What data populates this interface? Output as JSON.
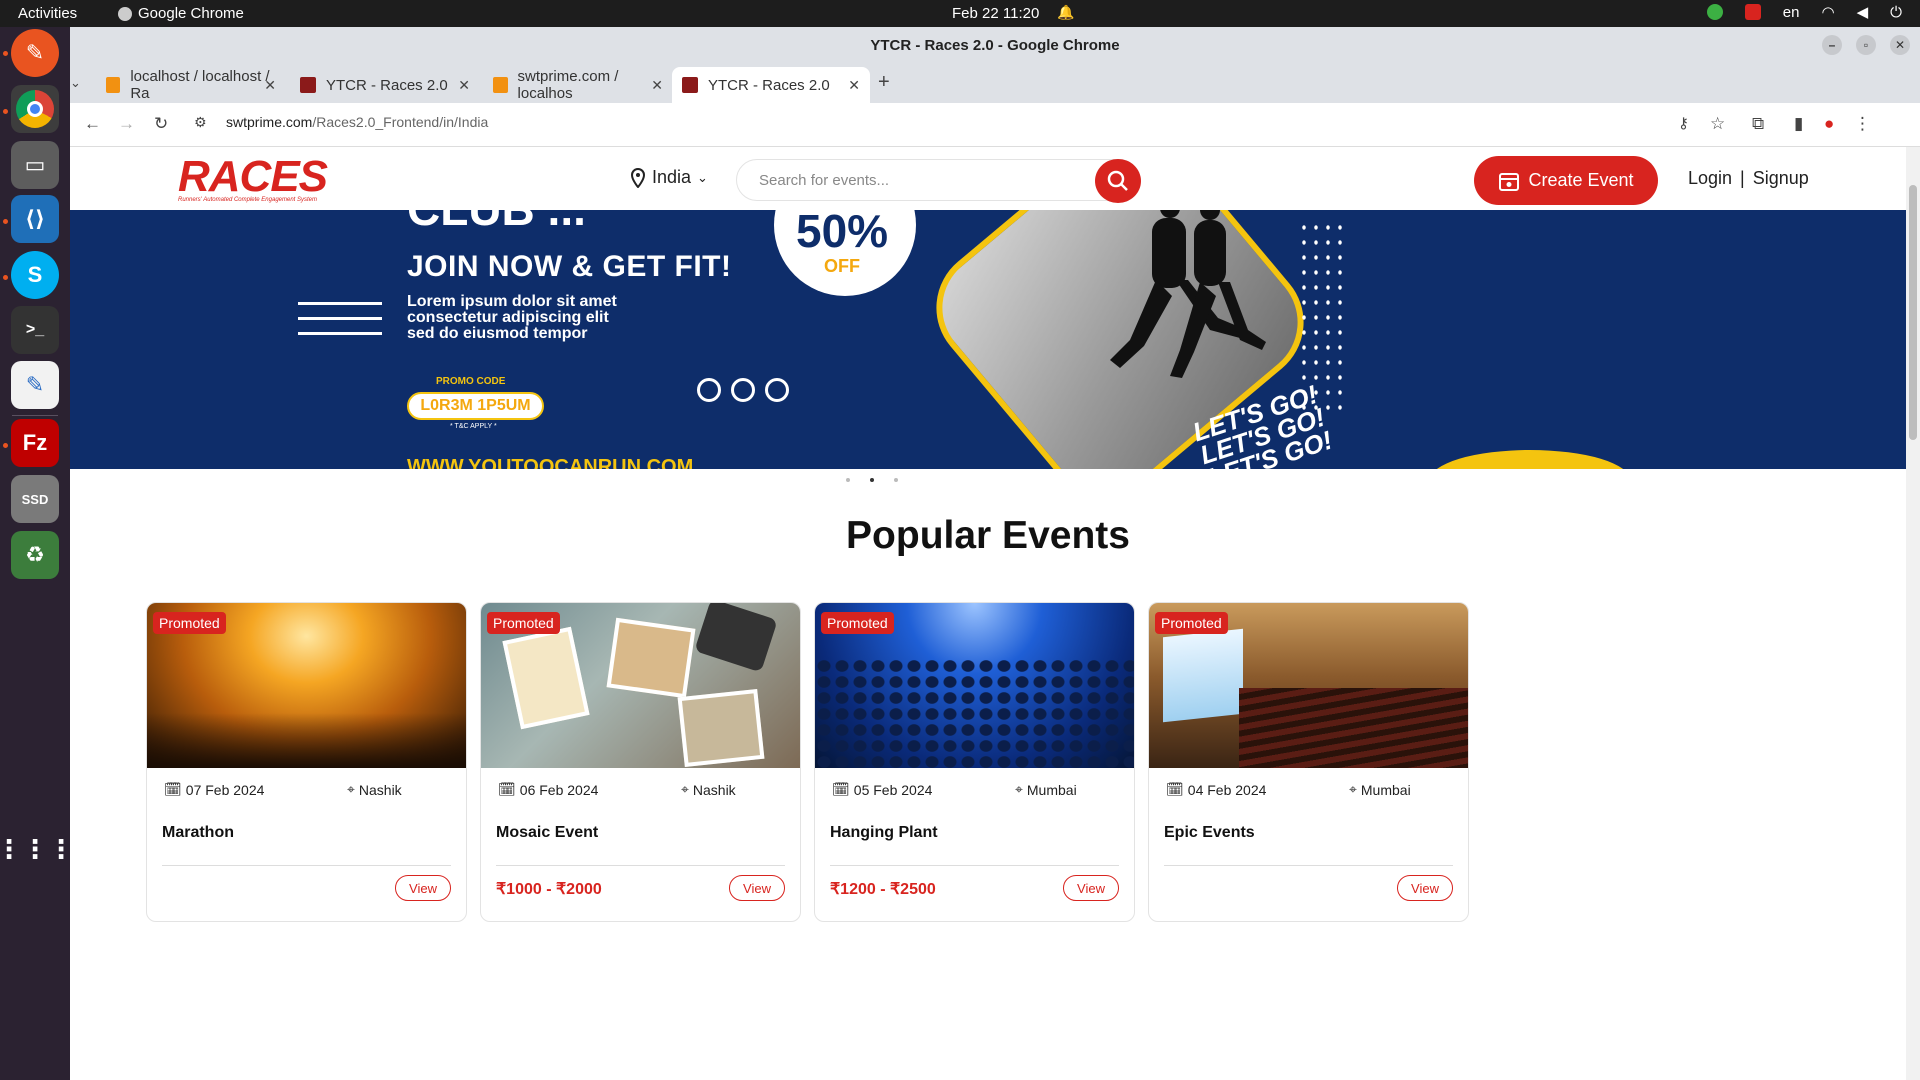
{
  "system": {
    "activities": "Activities",
    "app_name": "Google Chrome",
    "clock": "Feb 22  11:20",
    "lang": "en"
  },
  "browser": {
    "window_title": "YTCR - Races 2.0 - Google Chrome",
    "tabs": [
      {
        "label": "localhost / localhost / Ra",
        "active": false
      },
      {
        "label": "YTCR - Races 2.0",
        "active": false
      },
      {
        "label": "swtprime.com / localhos",
        "active": false
      },
      {
        "label": "YTCR - Races 2.0",
        "active": true
      }
    ],
    "url_host": "swtprime.com",
    "url_path": "/Races2.0_Frontend/in/India"
  },
  "header": {
    "logo_text": "RACES",
    "logo_tagline": "Runners' Automated Complete Engagement System",
    "country": "India",
    "search_placeholder": "Search for events...",
    "create_event": "Create Event",
    "login": "Login",
    "separator": "|",
    "signup": "Signup"
  },
  "banner": {
    "club_text": "CLUB ...",
    "join_text": "JOIN NOW & GET FIT!",
    "body_lines": [
      "Lorem ipsum dolor sit amet",
      "consectetur adipiscing elit",
      "sed do eiusmod tempor"
    ],
    "promo_label": "PROMO CODE",
    "promo_code": "L0R3M 1P5UM",
    "tc": "* T&C APPLY *",
    "website": "WWW.YOUTOOCANRUN.COM",
    "discount": "50%",
    "discount_off": "OFF",
    "lets_go": [
      "LET'S GO!",
      "LET'S GO!",
      "LET'S GO!"
    ],
    "active_slide": 2,
    "slide_count": 3
  },
  "section_title": "Popular Events",
  "events": [
    {
      "badge": "Promoted",
      "date": "07 Feb 2024",
      "location": "Nashik",
      "name": "Marathon",
      "price": "",
      "view": "View"
    },
    {
      "badge": "Promoted",
      "date": "06 Feb 2024",
      "location": "Nashik",
      "name": "Mosaic Event",
      "price": "₹1000 - ₹2000",
      "view": "View"
    },
    {
      "badge": "Promoted",
      "date": "05 Feb 2024",
      "location": "Mumbai",
      "name": "Hanging Plant",
      "price": "₹1200 - ₹2500",
      "view": "View"
    },
    {
      "badge": "Promoted",
      "date": "04 Feb 2024",
      "location": "Mumbai",
      "name": "Epic Events",
      "price": "",
      "view": "View"
    }
  ],
  "colors": {
    "brand_red": "#d8241f",
    "banner_blue": "#0e2d6a",
    "banner_yellow": "#f4c40f"
  }
}
